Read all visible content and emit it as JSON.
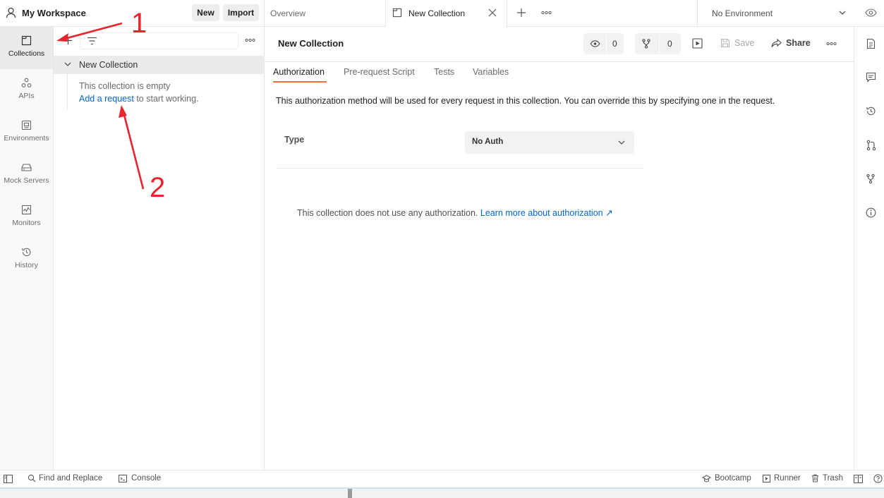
{
  "workspace": {
    "title": "My Workspace",
    "new_label": "New",
    "import_label": "Import"
  },
  "nav": [
    {
      "label": "Collections",
      "icon": "collections-icon"
    },
    {
      "label": "APIs",
      "icon": "apis-icon"
    },
    {
      "label": "Environments",
      "icon": "environments-icon"
    },
    {
      "label": "Mock Servers",
      "icon": "mock-servers-icon"
    },
    {
      "label": "Monitors",
      "icon": "monitors-icon"
    },
    {
      "label": "History",
      "icon": "history-icon"
    }
  ],
  "sidebar": {
    "collection_name": "New Collection",
    "empty_title": "This collection is empty",
    "add_request_link": "Add a request",
    "empty_suffix": "to start working."
  },
  "tabs": {
    "overview": "Overview",
    "active": "New Collection",
    "environment": "No Environment"
  },
  "collection": {
    "title": "New Collection",
    "watch_count": "0",
    "fork_count": "0",
    "save_label": "Save",
    "share_label": "Share",
    "subtabs": [
      "Authorization",
      "Pre-request Script",
      "Tests",
      "Variables"
    ],
    "auth_description": "This authorization method will be used for every request in this collection. You can override this by specifying one in the request.",
    "type_label": "Type",
    "type_value": "No Auth",
    "no_auth_text": "This collection does not use any authorization.",
    "learn_more": "Learn more about authorization ↗"
  },
  "footer": {
    "find_replace": "Find and Replace",
    "console": "Console",
    "bootcamp": "Bootcamp",
    "runner": "Runner",
    "trash": "Trash"
  },
  "annotations": {
    "label_1": "1",
    "label_2": "2"
  },
  "colors": {
    "accent": "#ff6c37",
    "link": "#0265d2",
    "annotation": "#e8242e"
  }
}
